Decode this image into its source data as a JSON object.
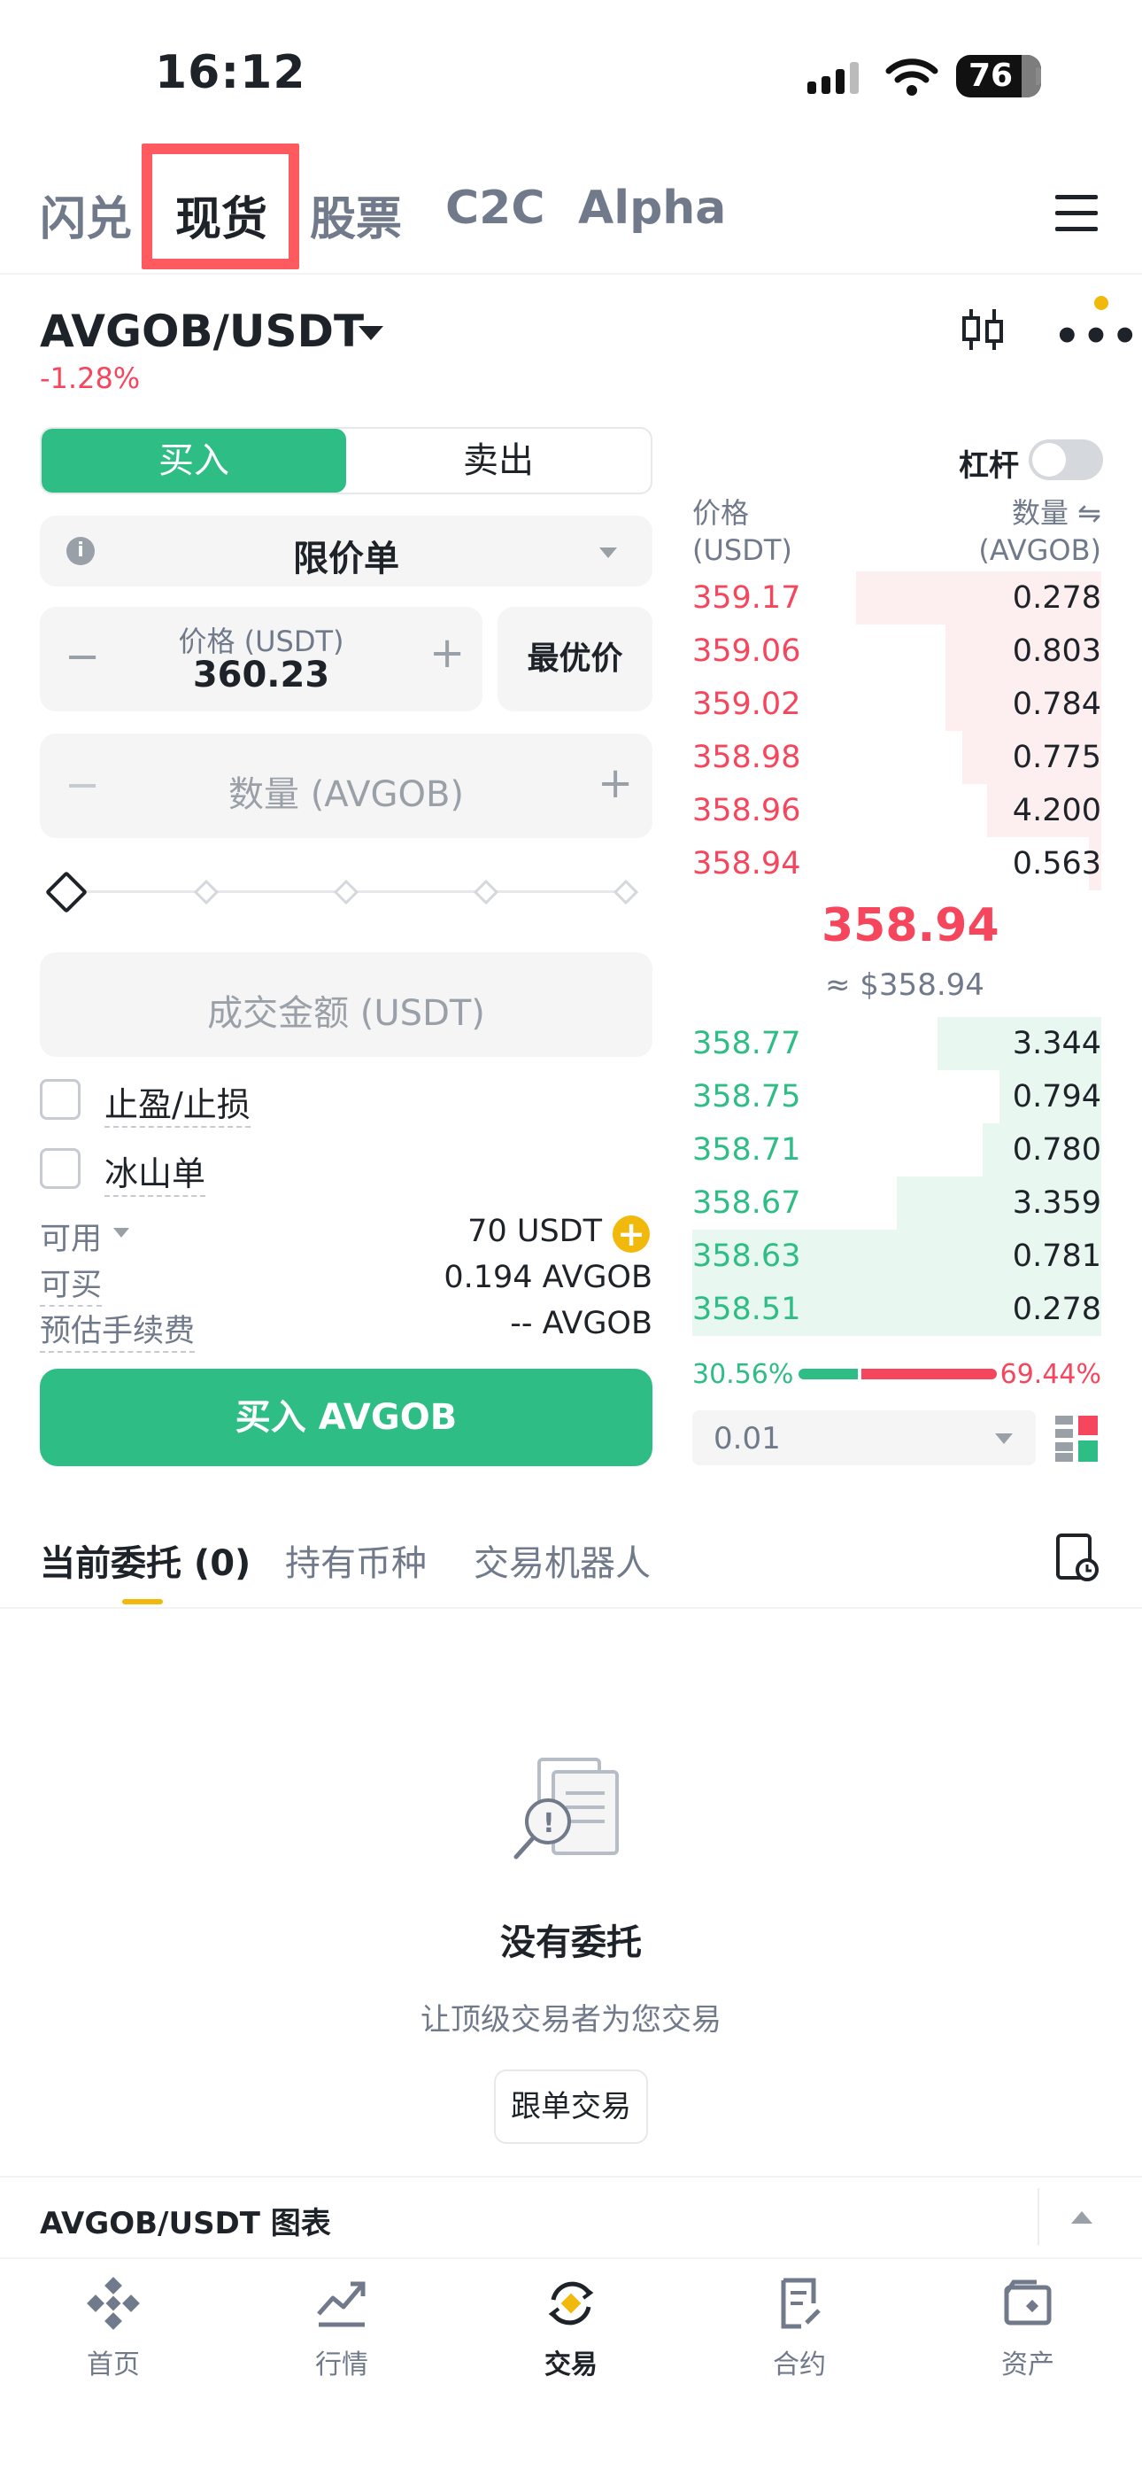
{
  "status_bar": {
    "time": "16:12",
    "battery": "76"
  },
  "top_tabs": [
    "闪兑",
    "现货",
    "股票",
    "C2C",
    "Alpha"
  ],
  "pair": {
    "symbol": "AVGOB/USDT",
    "change": "-1.28%"
  },
  "side_toggle": {
    "buy": "买入",
    "sell": "卖出"
  },
  "order_form": {
    "order_type": "限价单",
    "price_label": "价格 (USDT)",
    "price_value": "360.23",
    "best_price": "最优价",
    "qty_placeholder": "数量 (AVGOB)",
    "amount_placeholder": "成交金额 (USDT)",
    "tpsl": "止盈/止损",
    "iceberg": "冰山单",
    "available_label": "可用",
    "available_value": "70 USDT",
    "can_buy_label": "可买",
    "can_buy_value": "0.194 AVGOB",
    "fee_label": "预估手续费",
    "fee_value": "-- AVGOB",
    "submit": "买入 AVGOB"
  },
  "order_book": {
    "leverage_label": "杠杆",
    "head_price": "价格",
    "head_price_unit": "(USDT)",
    "head_qty": "数量 ⇋",
    "head_qty_unit": "(AVGOB)",
    "asks": [
      {
        "price": "359.17",
        "qty": "0.278",
        "depth": 0.6
      },
      {
        "price": "359.06",
        "qty": "0.803",
        "depth": 0.38
      },
      {
        "price": "359.02",
        "qty": "0.784",
        "depth": 0.38
      },
      {
        "price": "358.98",
        "qty": "0.775",
        "depth": 0.34
      },
      {
        "price": "358.96",
        "qty": "4.200",
        "depth": 0.28
      },
      {
        "price": "358.94",
        "qty": "0.563",
        "depth": 0.03
      }
    ],
    "mid_price": "358.94",
    "mid_usd": "≈ $358.94",
    "bids": [
      {
        "price": "358.77",
        "qty": "3.344",
        "depth": 0.4
      },
      {
        "price": "358.75",
        "qty": "0.794",
        "depth": 0.25
      },
      {
        "price": "358.71",
        "qty": "0.780",
        "depth": 0.29
      },
      {
        "price": "358.67",
        "qty": "3.359",
        "depth": 0.5
      },
      {
        "price": "358.63",
        "qty": "0.781",
        "depth": 1.0
      },
      {
        "price": "358.51",
        "qty": "0.278",
        "depth": 1.0
      }
    ],
    "buy_ratio": "30.56%",
    "sell_ratio": "69.44%",
    "buy_ratio_value": 0.3056,
    "precision": "0.01"
  },
  "bottom_tabs": {
    "open_orders": "当前委托 (0)",
    "holdings": "持有币种",
    "bots": "交易机器人"
  },
  "empty_state": {
    "title": "没有委托",
    "subtitle": "让顶级交易者为您交易",
    "button": "跟单交易"
  },
  "chart_bar": {
    "label": "AVGOB/USDT 图表"
  },
  "nav": [
    "首页",
    "行情",
    "交易",
    "合约",
    "资产"
  ],
  "colors": {
    "buy": "#2ebd85",
    "sell": "#f6465d",
    "accent": "#f0b90b",
    "highlight_box": "#ff5a5f"
  }
}
